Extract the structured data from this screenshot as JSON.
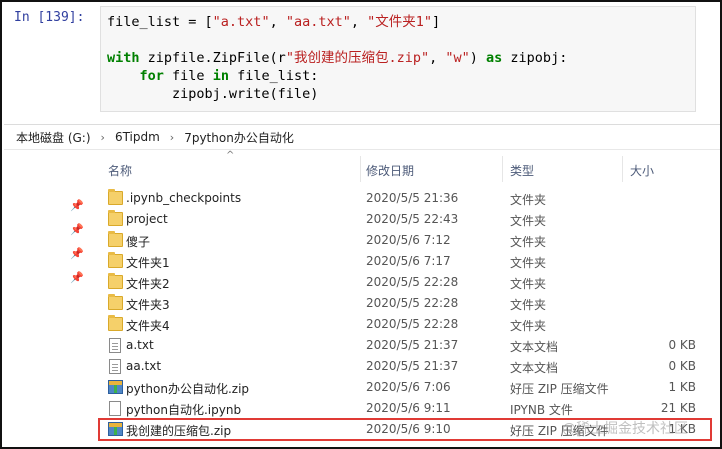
{
  "notebook": {
    "prompt": "In  [139]:",
    "code_lines": [
      [
        {
          "t": "file_list = [",
          "c": ""
        },
        {
          "t": "\"a.txt\"",
          "c": "str"
        },
        {
          "t": ", ",
          "c": ""
        },
        {
          "t": "\"aa.txt\"",
          "c": "str"
        },
        {
          "t": ", ",
          "c": ""
        },
        {
          "t": "\"文件夹1\"",
          "c": "str"
        },
        {
          "t": "]",
          "c": ""
        }
      ],
      [],
      [
        {
          "t": "with",
          "c": "kw"
        },
        {
          "t": " zipfile.ZipFile(r",
          "c": ""
        },
        {
          "t": "\"我创建的压缩包.zip\"",
          "c": "str"
        },
        {
          "t": ", ",
          "c": ""
        },
        {
          "t": "\"w\"",
          "c": "str"
        },
        {
          "t": ") ",
          "c": ""
        },
        {
          "t": "as",
          "c": "kw"
        },
        {
          "t": " zipobj:",
          "c": ""
        }
      ],
      [
        {
          "t": "    ",
          "c": ""
        },
        {
          "t": "for",
          "c": "kw"
        },
        {
          "t": " file ",
          "c": ""
        },
        {
          "t": "in",
          "c": "kw"
        },
        {
          "t": " file_list:",
          "c": ""
        }
      ],
      [
        {
          "t": "        zipobj.write(file)",
          "c": ""
        }
      ]
    ]
  },
  "explorer": {
    "breadcrumb": [
      "本地磁盘 (G:)",
      "6Tipdm",
      "7python办公自动化"
    ],
    "columns": {
      "name": "名称",
      "date": "修改日期",
      "type": "类型",
      "size": "大小"
    },
    "files": [
      {
        "name": ".ipynb_checkpoints",
        "date": "2020/5/5 21:36",
        "type": "文件夹",
        "size": "",
        "icon": "folder-icon"
      },
      {
        "name": "project",
        "date": "2020/5/5 22:43",
        "type": "文件夹",
        "size": "",
        "icon": "folder-icon"
      },
      {
        "name": "傻子",
        "date": "2020/5/6 7:12",
        "type": "文件夹",
        "size": "",
        "icon": "folder-icon"
      },
      {
        "name": "文件夹1",
        "date": "2020/5/6 7:17",
        "type": "文件夹",
        "size": "",
        "icon": "folder-icon"
      },
      {
        "name": "文件夹2",
        "date": "2020/5/5 22:28",
        "type": "文件夹",
        "size": "",
        "icon": "folder-icon"
      },
      {
        "name": "文件夹3",
        "date": "2020/5/5 22:28",
        "type": "文件夹",
        "size": "",
        "icon": "folder-icon"
      },
      {
        "name": "文件夹4",
        "date": "2020/5/5 22:28",
        "type": "文件夹",
        "size": "",
        "icon": "folder-icon"
      },
      {
        "name": "a.txt",
        "date": "2020/5/5 21:37",
        "type": "文本文档",
        "size": "0 KB",
        "icon": "txt-icon"
      },
      {
        "name": "aa.txt",
        "date": "2020/5/5 21:37",
        "type": "文本文档",
        "size": "0 KB",
        "icon": "txt-icon"
      },
      {
        "name": "python办公自动化.zip",
        "date": "2020/5/6 7:06",
        "type": "好压 ZIP 压缩文件",
        "size": "1 KB",
        "icon": "zip-icon"
      },
      {
        "name": "python自动化.ipynb",
        "date": "2020/5/6 9:11",
        "type": "IPYNB 文件",
        "size": "21 KB",
        "icon": "nb-icon"
      },
      {
        "name": "我创建的压缩包.zip",
        "date": "2020/5/6 9:10",
        "type": "好压 ZIP 压缩文件",
        "size": "1 KB",
        "icon": "zip-icon"
      }
    ],
    "highlighted_file": "我创建的压缩包.zip",
    "watermark": "@稀土掘金技术社区",
    "colors": {
      "highlight": "#e03a35",
      "folder": "#f5d06a",
      "header_text": "#4d5b79"
    }
  }
}
